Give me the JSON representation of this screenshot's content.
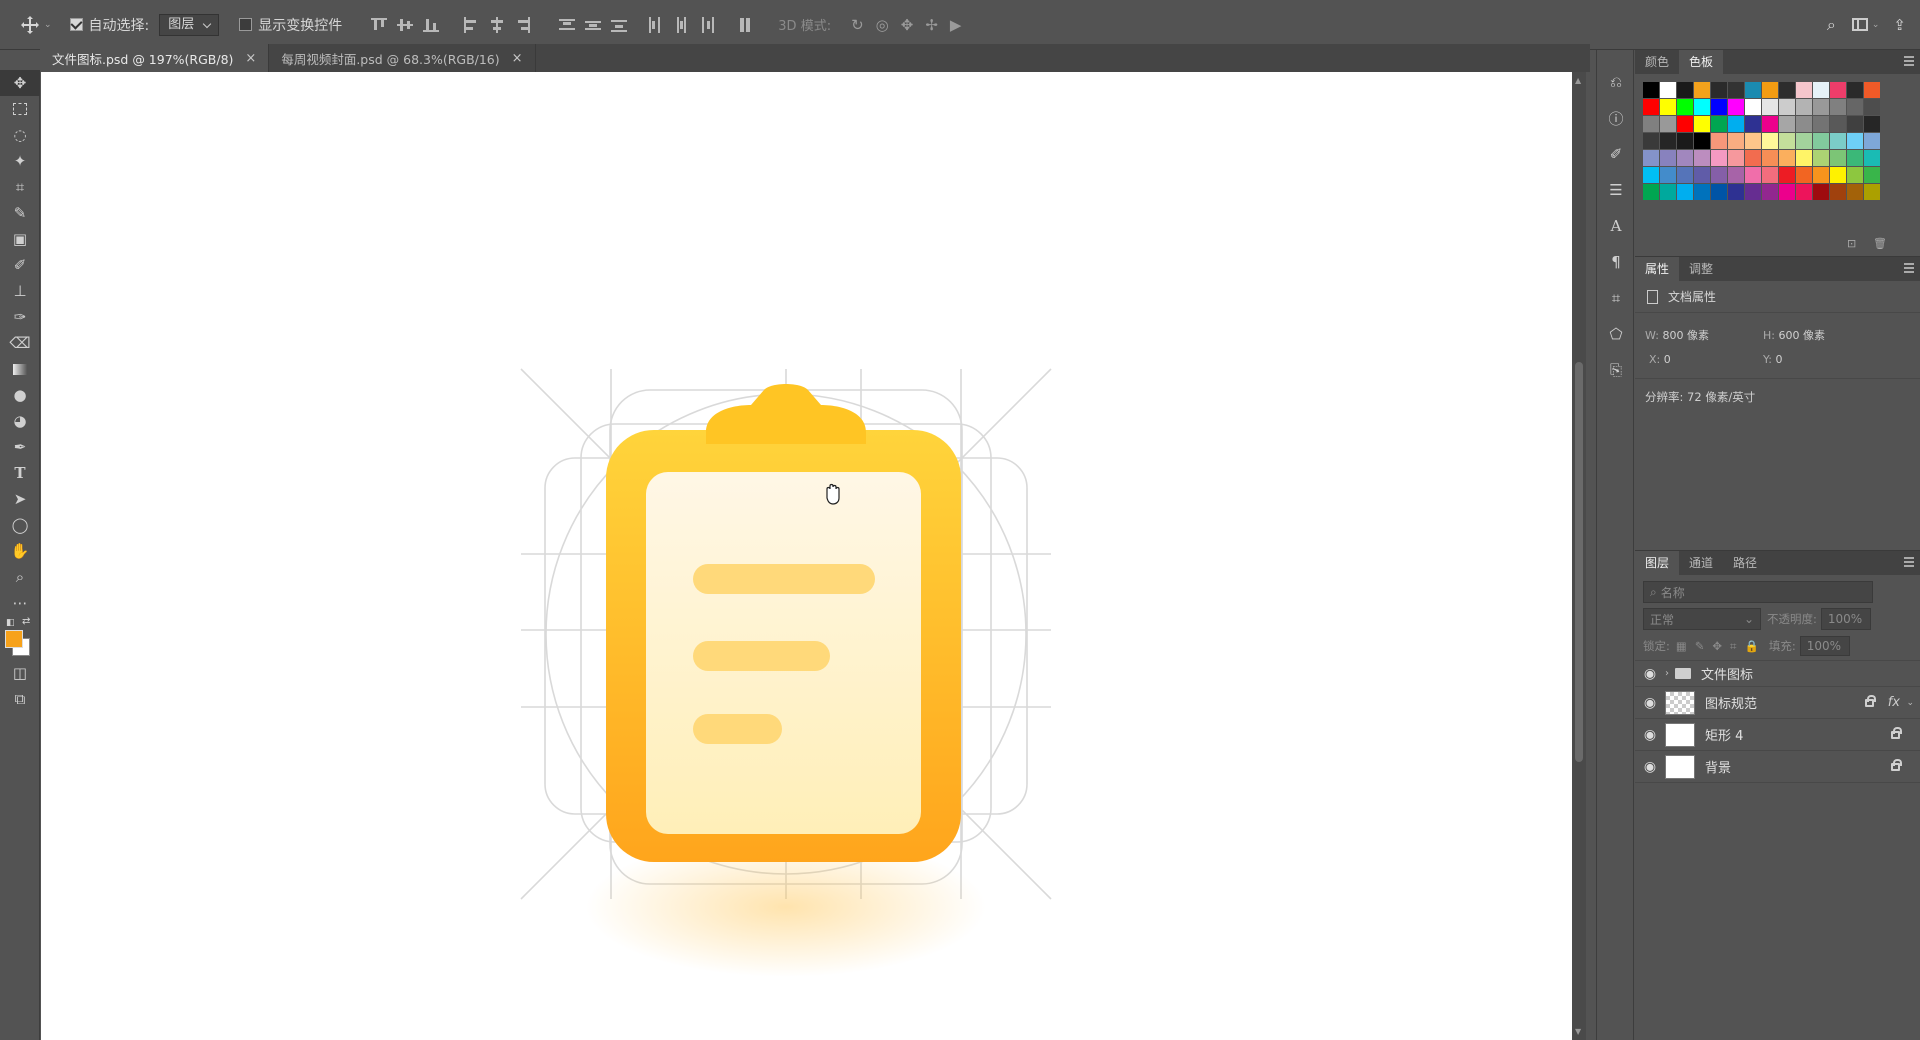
{
  "options_bar": {
    "auto_select_label": "自动选择:",
    "auto_select_value": "图层",
    "show_transform_label": "显示变换控件",
    "mode_3d_label": "3D 模式:"
  },
  "tabs": [
    {
      "label": "文件图标.psd @ 197%(RGB/8)",
      "close": "×"
    },
    {
      "label": "每周视频封面.psd @ 68.3%(RGB/16)",
      "close": "×"
    }
  ],
  "swatches_panel": {
    "tab_color": "颜色",
    "tab_swatches": "色板",
    "colors": [
      "#000000",
      "#ffffff",
      "#1a1a1a",
      "#f4a21c",
      "#2b2b2b",
      "#333333",
      "#1b8bb0",
      "#f39c12",
      "#2d2d2d",
      "#f5c6cc",
      "#e6f2f8",
      "#ee3d6a",
      "#2a2a2a",
      "#f05a28",
      "#ff0000",
      "#ffff00",
      "#00ff00",
      "#00ffff",
      "#0000ff",
      "#ff00ff",
      "#ffffff",
      "#e5e5e5",
      "#cccccc",
      "#b3b3b3",
      "#999999",
      "#808080",
      "#666666",
      "#4d4d4d",
      "#808080",
      "#999999",
      "#ff0000",
      "#ffff00",
      "#00a651",
      "#00aeef",
      "#2e3192",
      "#ec008c",
      "#a6a6a6",
      "#8c8c8c",
      "#737373",
      "#595959",
      "#404040",
      "#262626",
      "#3a3a3a",
      "#262626",
      "#1a1a1a",
      "#000000",
      "#f7977a",
      "#f9ad81",
      "#fdc68a",
      "#fff79a",
      "#c4df9b",
      "#a3d39c",
      "#82ca9d",
      "#7bcdc8",
      "#6ecff6",
      "#7ea7d8",
      "#8493ca",
      "#8882be",
      "#a187be",
      "#bc8dbf",
      "#f49ac2",
      "#f6989d",
      "#f26c4f",
      "#f68e56",
      "#fbaf5d",
      "#fff467",
      "#acd373",
      "#7cc576",
      "#3bb878",
      "#1abbb4",
      "#00bff3",
      "#438ccb",
      "#5574b9",
      "#605ca8",
      "#855fa8",
      "#a763a8",
      "#f06eaa",
      "#f26d7d",
      "#ed1c24",
      "#f26522",
      "#f7941d",
      "#fff200",
      "#8dc73f",
      "#39b54a",
      "#00a651",
      "#00a99d",
      "#00aeef",
      "#0072bc",
      "#0054a6",
      "#2e3192",
      "#662d91",
      "#92278f",
      "#ec008c",
      "#ed145b",
      "#9e0b0f",
      "#a0410d",
      "#a36209",
      "#aba000"
    ]
  },
  "properties_panel": {
    "tab_properties": "属性",
    "tab_adjust": "调整",
    "doc_props": "文档属性",
    "w_label": "W:",
    "w_value": "800 像素",
    "h_label": "H:",
    "h_value": "600 像素",
    "x_label": "X:",
    "x_value": "0",
    "y_label": "Y:",
    "y_value": "0",
    "resolution": "分辨率: 72 像素/英寸"
  },
  "layers_panel": {
    "tab_layers": "图层",
    "tab_channels": "通道",
    "tab_paths": "路径",
    "search_placeholder": "名称",
    "blend_mode": "正常",
    "opacity_label": "不透明度:",
    "opacity_value": "100%",
    "lock_label": "锁定:",
    "fill_label": "填充:",
    "fill_value": "100%",
    "layers": [
      {
        "name": "文件图标",
        "kind": "group"
      },
      {
        "name": "图标规范",
        "kind": "smart",
        "fx": "fx"
      },
      {
        "name": "矩形 4",
        "kind": "smart"
      },
      {
        "name": "背景",
        "kind": "background"
      }
    ]
  },
  "colors": {
    "foreground": "#f7a21b",
    "background": "#ffffff",
    "icon_yellow_top": "#ffd43b",
    "icon_orange_bottom": "#ffa51c",
    "paper_top": "#fff7e6",
    "paper_bottom": "#ffefb8",
    "line_color": "#ffd97a"
  }
}
